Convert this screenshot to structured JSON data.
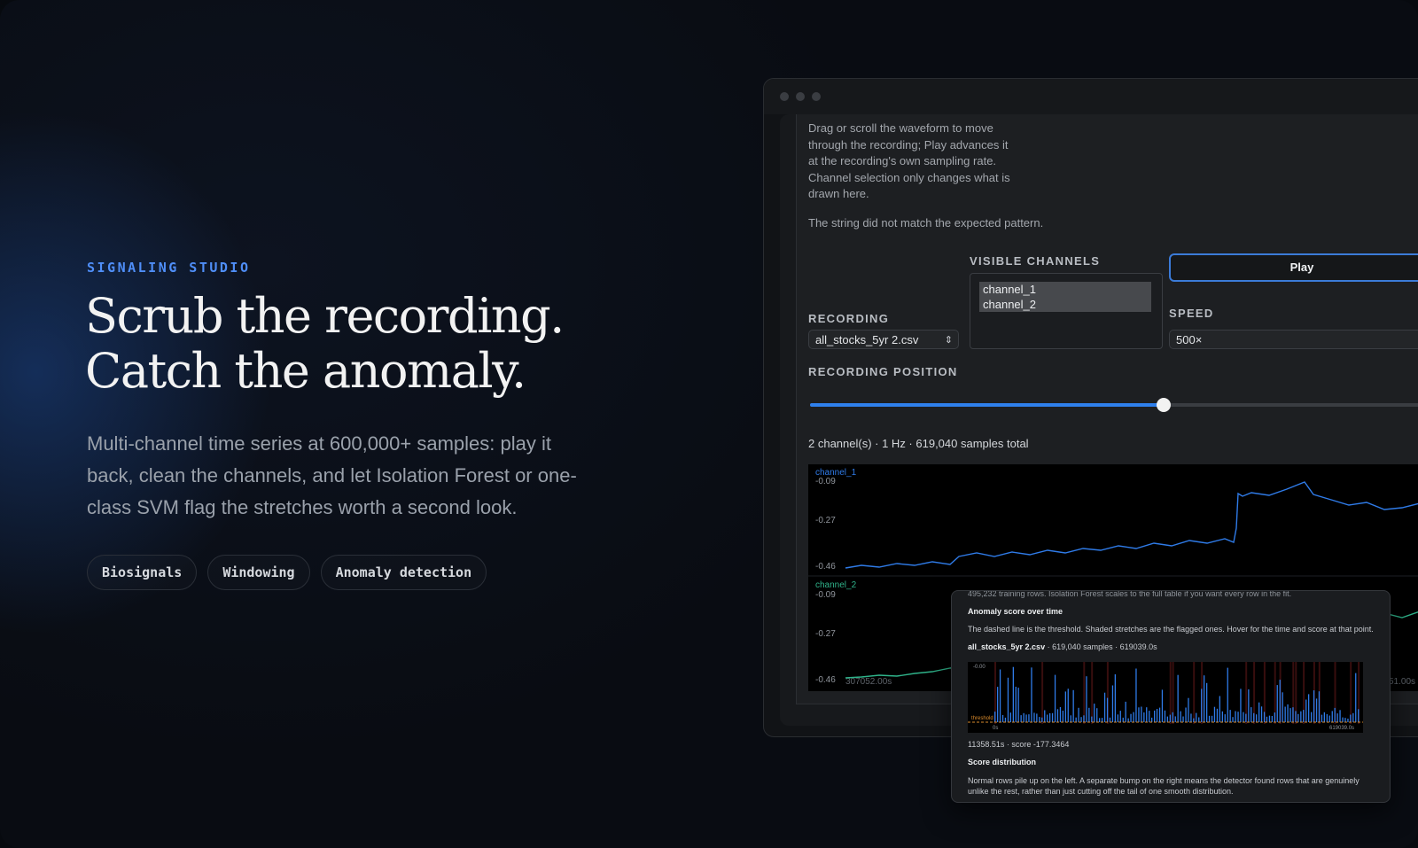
{
  "hero": {
    "eyebrow": "SIGNALING STUDIO",
    "headline_line1": "Scrub the recording.",
    "headline_line2": "Catch the anomaly.",
    "subtitle": "Multi-channel time series at 600,000+ samples: play it back, clean the channels, and let Isolation Forest or one-class SVM flag the stretches worth a second look.",
    "tags": [
      "Biosignals",
      "Windowing",
      "Anomaly detection"
    ]
  },
  "app": {
    "instructions": "Drag or scroll the waveform to move through the recording; Play advances it at the recording's own sampling rate. Channel selection only changes what is drawn here.",
    "error_message": "The string did not match the expected pattern.",
    "visible_channels_label": "VISIBLE CHANNELS",
    "channel_options": [
      "channel_1",
      "channel_2"
    ],
    "play_label": "Play",
    "recording_label": "RECORDING",
    "recording_value": "all_stocks_5yr 2.csv",
    "speed_label": "SPEED",
    "speed_value": "500×",
    "position_label": "RECORDING POSITION",
    "position_fraction": 0.57,
    "summary": "2 channel(s) · 1 Hz · 619,040 samples total",
    "waveform": {
      "channel_1": {
        "name": "channel_1",
        "ticks": [
          "-0.09",
          "-0.27",
          "-0.46"
        ],
        "color": "#2f7be8"
      },
      "channel_2": {
        "name": "channel_2",
        "ticks": [
          "-0.09",
          "-0.27",
          "-0.46"
        ],
        "color": "#2fb38a"
      },
      "start_time": "307052.00s",
      "end_time": "51.00s"
    },
    "anomaly_card": {
      "rows_note": "495,232 training rows. Isolation Forest scales to the full table if you want every row in the fit.",
      "score_title": "Anomaly score over time",
      "score_desc": "The dashed line is the threshold. Shaded stretches are the flagged ones. Hover for the time and score at that point.",
      "file_name": "all_stocks_5yr 2.csv",
      "file_meta": " · 619,040 samples · 619039.0s",
      "mini_top": "-0.00",
      "mini_threshold": "threshold",
      "mini_start": "0s",
      "mini_end": "619039.0s",
      "hover_readout": "11358.51s · score -177.3464",
      "dist_title": "Score distribution",
      "dist_desc": "Normal rows pile up on the left. A separate bump on the right means the detector found rows that are genuinely unlike the rest, rather than just cutting off the tail of one smooth distribution."
    }
  },
  "colors": {
    "accent": "#4f8ef7",
    "slider": "#2f80ed",
    "channel_1": "#2f7be8",
    "channel_2": "#2fb38a"
  }
}
